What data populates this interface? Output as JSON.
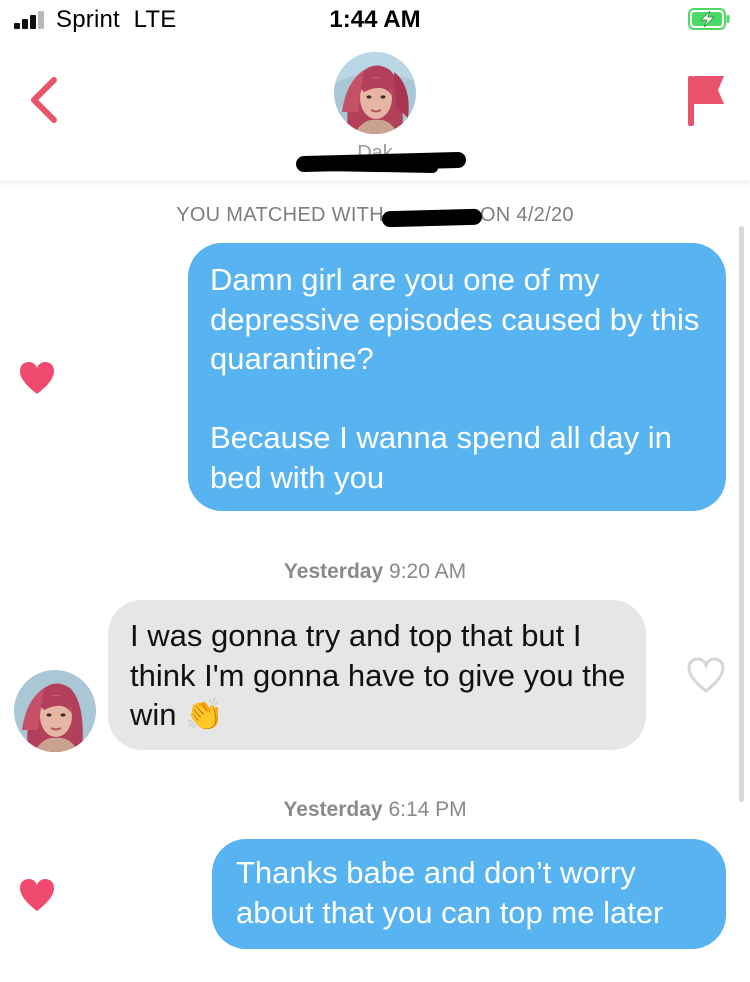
{
  "status_bar": {
    "carrier": "Sprint",
    "network": "LTE",
    "time": "1:44 AM",
    "battery_icon": "charging-battery-icon"
  },
  "header": {
    "back_icon": "chevron-left-icon",
    "report_icon": "flag-icon",
    "match_name": "Dak"
  },
  "chat": {
    "matched_text_prefix": "YOU MATCHED WITH",
    "matched_text_suffix": "ON 4/2/20",
    "messages": [
      {
        "sender": "me",
        "text": "Damn girl are you one of my depressive episodes caused by this quarantine?\n\nBecause I wanna spend all day in bed with you",
        "liked": true
      },
      {
        "timestamp_day": "Yesterday",
        "timestamp_time": "9:20 AM"
      },
      {
        "sender": "them",
        "text": "I was gonna try and top that but I think I'm gonna have to give you the win",
        "emoji": "👏",
        "liked": false
      },
      {
        "timestamp_day": "Yesterday",
        "timestamp_time": "6:14 PM"
      },
      {
        "sender": "me",
        "text": "Thanks babe and don’t worry about that you can top me later",
        "liked": true
      }
    ]
  },
  "colors": {
    "outgoing_bubble": "#58b4f1",
    "incoming_bubble": "#e6e6e6",
    "accent": "#f04a6e",
    "heart_liked": "#f04a6e",
    "heart_unliked": "#d6d6d6"
  }
}
